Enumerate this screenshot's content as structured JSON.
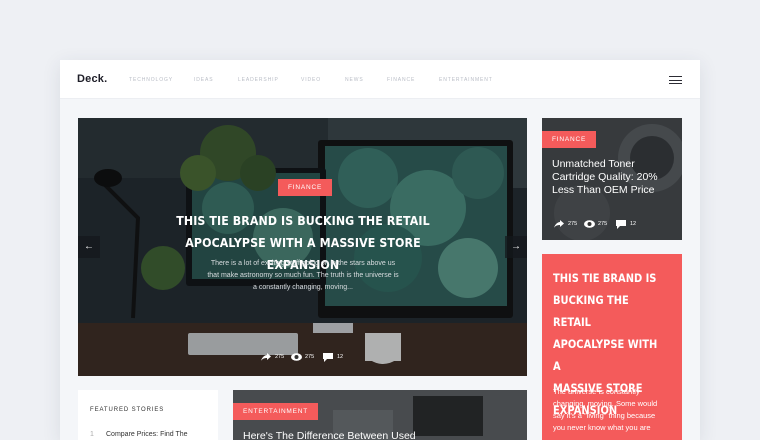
{
  "brand": {
    "logo": "Deck."
  },
  "nav": {
    "items": [
      {
        "label": "TECHNOLOGY"
      },
      {
        "label": "IDEAS"
      },
      {
        "label": "LEADERSHIP"
      },
      {
        "label": "VIDEO"
      },
      {
        "label": "NEWS"
      },
      {
        "label": "FINANCE"
      },
      {
        "label": "ENTERTAINMENT"
      }
    ]
  },
  "hero": {
    "category": "FINANCE",
    "title_line1": "THIS TIE BRAND IS BUCKING THE RETAIL",
    "title_line2": "APOCALYPSE WITH A MASSIVE STORE EXPANSION",
    "text_line1": "There is a lot of exciting stuff going on in the stars above us",
    "text_line2": "that make astronomy so much fun. The truth is the universe is",
    "text_line3": "a constantly changing, moving...",
    "shares": "275",
    "views": "275",
    "comments": "12",
    "prev_icon": "arrow-left-icon",
    "next_icon": "arrow-right-icon"
  },
  "side_card": {
    "category": "FINANCE",
    "title_line1": "Unmatched Toner",
    "title_line2": "Cartridge Quality: 20%",
    "title_line3": "Less Than OEM Price",
    "shares": "275",
    "views": "275",
    "comments": "12"
  },
  "promo": {
    "title_line1": "THIS TIE BRAND IS",
    "title_line2": "BUCKING THE RETAIL",
    "title_line3": "APOCALYPSE WITH A",
    "title_line4": "MASSIVE STORE",
    "title_line5": "EXPANSION",
    "text_line1": "The universe is constantly",
    "text_line2": "changing, moving. Some would",
    "text_line3": "say it's a \"living\" thing because",
    "text_line4": "you never know what you are"
  },
  "featured": {
    "heading": "FEATURED STORIES",
    "items": [
      {
        "num": "1",
        "title": "Compare Prices: Find The"
      }
    ]
  },
  "mid_card": {
    "category": "ENTERTAINMENT",
    "title": "Here's The Difference Between Used"
  },
  "colors": {
    "accent": "#f45b5b",
    "background": "#eef0f4",
    "text_dark": "#1e1e28"
  },
  "icons": [
    "share-icon",
    "eye-icon",
    "comment-icon",
    "menu-icon"
  ]
}
